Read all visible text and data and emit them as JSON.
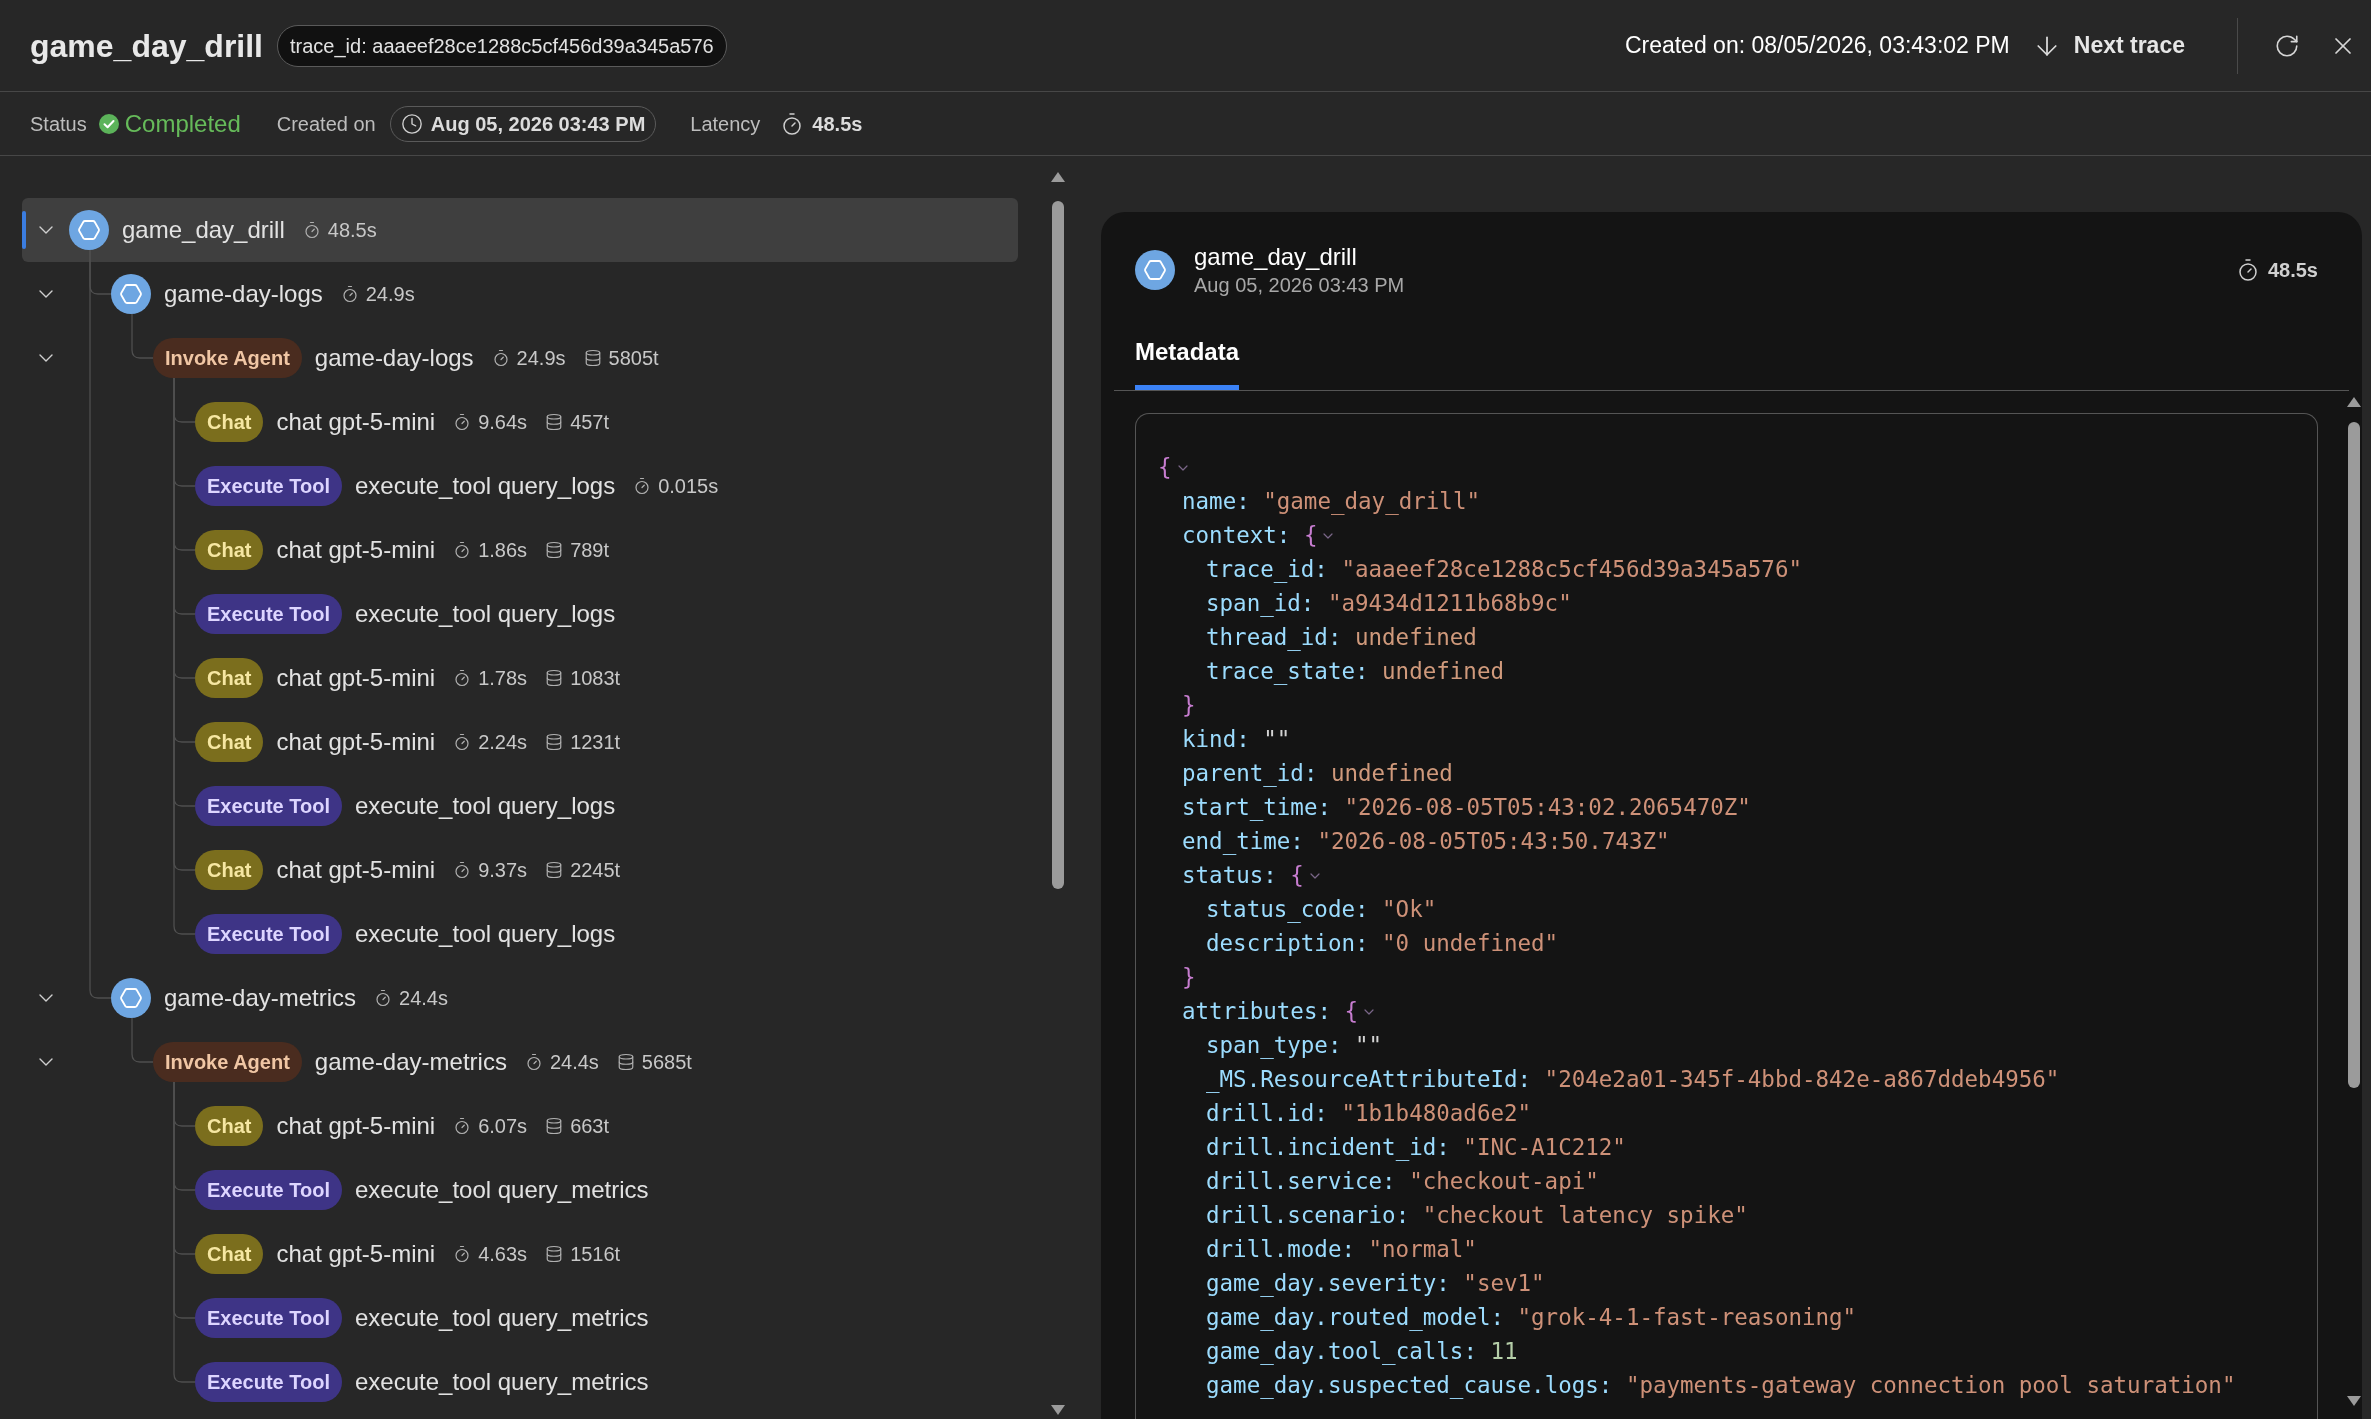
{
  "header": {
    "title": "game_day_drill",
    "trace_id": "trace_id: aaaeef28ce1288c5cf456d39a345a576",
    "created": "Created on: 08/05/2026, 03:43:02 PM",
    "next_button": "Next trace"
  },
  "summary": {
    "status_label": "Status",
    "status": {
      "kind": "success",
      "label": "Completed"
    },
    "created_label": "Created on",
    "created": "Aug 05, 2026 03:43 PM",
    "latency_label": "Latency",
    "latency": "48.5s"
  },
  "spans": [
    {
      "kind": "span",
      "name": "game_day_drill",
      "duration": "48.5s",
      "expanded": true,
      "selected": true,
      "children": [
        {
          "kind": "span",
          "name": "game-day-logs",
          "duration": "24.9s",
          "expanded": true,
          "selected": false,
          "children": [
            {
              "kind": "agent",
              "badge": "Invoke Agent",
              "name": "game-day-logs",
              "duration": "24.9s",
              "tokens": "5805t",
              "expanded": true,
              "selected": false,
              "children": [
                {
                  "kind": "chat",
                  "badge": "Chat",
                  "name": "chat gpt-5-mini",
                  "duration": "9.64s",
                  "tokens": "457t",
                  "selected": false
                },
                {
                  "kind": "tool",
                  "badge": "Execute Tool",
                  "name": "execute_tool query_logs",
                  "duration": "0.015s",
                  "selected": false
                },
                {
                  "kind": "chat",
                  "badge": "Chat",
                  "name": "chat gpt-5-mini",
                  "duration": "1.86s",
                  "tokens": "789t",
                  "selected": false
                },
                {
                  "kind": "tool",
                  "badge": "Execute Tool",
                  "name": "execute_tool query_logs",
                  "selected": false
                },
                {
                  "kind": "chat",
                  "badge": "Chat",
                  "name": "chat gpt-5-mini",
                  "duration": "1.78s",
                  "tokens": "1083t",
                  "selected": false
                },
                {
                  "kind": "chat",
                  "badge": "Chat",
                  "name": "chat gpt-5-mini",
                  "duration": "2.24s",
                  "tokens": "1231t",
                  "selected": false
                },
                {
                  "kind": "tool",
                  "badge": "Execute Tool",
                  "name": "execute_tool query_logs",
                  "selected": false
                },
                {
                  "kind": "chat",
                  "badge": "Chat",
                  "name": "chat gpt-5-mini",
                  "duration": "9.37s",
                  "tokens": "2245t",
                  "selected": false
                },
                {
                  "kind": "tool",
                  "badge": "Execute Tool",
                  "name": "execute_tool query_logs",
                  "selected": false
                }
              ]
            }
          ]
        },
        {
          "kind": "span",
          "name": "game-day-metrics",
          "duration": "24.4s",
          "expanded": true,
          "selected": false,
          "children": [
            {
              "kind": "agent",
              "badge": "Invoke Agent",
              "name": "game-day-metrics",
              "duration": "24.4s",
              "tokens": "5685t",
              "expanded": true,
              "selected": false,
              "children": [
                {
                  "kind": "chat",
                  "badge": "Chat",
                  "name": "chat gpt-5-mini",
                  "duration": "6.07s",
                  "tokens": "663t",
                  "selected": false
                },
                {
                  "kind": "tool",
                  "badge": "Execute Tool",
                  "name": "execute_tool query_metrics",
                  "selected": false
                },
                {
                  "kind": "chat",
                  "badge": "Chat",
                  "name": "chat gpt-5-mini",
                  "duration": "4.63s",
                  "tokens": "1516t",
                  "selected": false
                },
                {
                  "kind": "tool",
                  "badge": "Execute Tool",
                  "name": "execute_tool query_metrics",
                  "selected": false
                },
                {
                  "kind": "tool",
                  "badge": "Execute Tool",
                  "name": "execute_tool query_metrics",
                  "selected": false
                }
              ]
            }
          ]
        }
      ]
    }
  ],
  "detail": {
    "name": "game_day_drill",
    "time": "Aug 05, 2026 03:43 PM",
    "duration": "48.5s",
    "tabs": [
      {
        "label": "Metadata",
        "selected": true
      }
    ],
    "metadata": {
      "kind": "object",
      "open": "{",
      "expanded": true,
      "children": [
        {
          "key": "name:",
          "kind": "string",
          "value": "\"game_day_drill\""
        },
        {
          "key": "context:",
          "kind": "object",
          "open": "{",
          "close": "}",
          "expanded": true,
          "children": [
            {
              "key": "trace_id:",
              "kind": "string",
              "value": "\"aaaeef28ce1288c5cf456d39a345a576\""
            },
            {
              "key": "span_id:",
              "kind": "string",
              "value": "\"a9434d1211b68b9c\""
            },
            {
              "key": "thread_id:",
              "kind": "undefined",
              "value": "undefined"
            },
            {
              "key": "trace_state:",
              "kind": "undefined",
              "value": "undefined"
            }
          ]
        },
        {
          "key": "kind:",
          "kind": "empty",
          "value": "\"\""
        },
        {
          "key": "parent_id:",
          "kind": "undefined",
          "value": "undefined"
        },
        {
          "key": "start_time:",
          "kind": "string",
          "value": "\"2026-08-05T05:43:02.2065470Z\""
        },
        {
          "key": "end_time:",
          "kind": "string",
          "value": "\"2026-08-05T05:43:50.743Z\""
        },
        {
          "key": "status:",
          "kind": "object",
          "open": "{",
          "close": "}",
          "expanded": true,
          "children": [
            {
              "key": "status_code:",
              "kind": "string",
              "value": "\"Ok\""
            },
            {
              "key": "description:",
              "kind": "string",
              "value": "\"0 undefined\""
            }
          ]
        },
        {
          "key": "attributes:",
          "kind": "object",
          "open": "{",
          "expanded": true,
          "children": [
            {
              "key": "span_type:",
              "kind": "empty",
              "value": "\"\""
            },
            {
              "key": "_MS.ResourceAttributeId:",
              "kind": "string",
              "value": "\"204e2a01-345f-4bbd-842e-a867ddeb4956\""
            },
            {
              "key": "drill.id:",
              "kind": "string",
              "value": "\"1b1b480ad6e2\""
            },
            {
              "key": "drill.incident_id:",
              "kind": "string",
              "value": "\"INC-A1C212\""
            },
            {
              "key": "drill.service:",
              "kind": "string",
              "value": "\"checkout-api\""
            },
            {
              "key": "drill.scenario:",
              "kind": "string",
              "value": "\"checkout latency spike\""
            },
            {
              "key": "drill.mode:",
              "kind": "string",
              "value": "\"normal\""
            },
            {
              "key": "game_day.severity:",
              "kind": "string",
              "value": "\"sev1\""
            },
            {
              "key": "game_day.routed_model:",
              "kind": "string",
              "value": "\"grok-4-1-fast-reasoning\""
            },
            {
              "key": "game_day.tool_calls:",
              "kind": "number",
              "value": "11"
            },
            {
              "key": "game_day.suspected_cause.logs:",
              "kind": "string",
              "value": "\"payments-gateway connection pool saturation\""
            }
          ]
        }
      ]
    }
  }
}
